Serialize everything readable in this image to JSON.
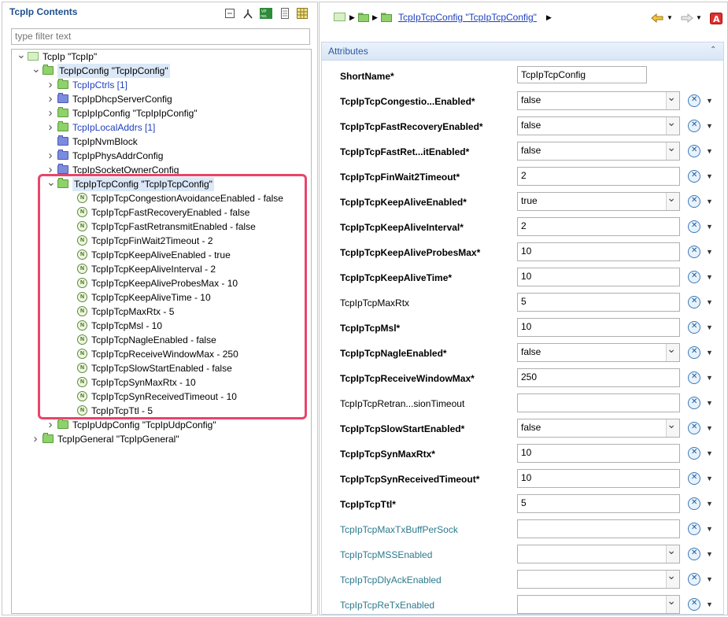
{
  "left": {
    "title": "TcpIp Contents",
    "filter_placeholder": "type filter text",
    "tree": [
      {
        "label": "TcpIp \"TcpIp\"",
        "indent": 0,
        "twisty": "open",
        "icon": "root"
      },
      {
        "label": "TcpIpConfig \"TcpIpConfig\"",
        "indent": 1,
        "twisty": "open",
        "icon": "folder-green",
        "selected": true
      },
      {
        "label": "TcpIpCtrls [1]",
        "indent": 2,
        "twisty": "closed",
        "icon": "folder-green",
        "blue": true
      },
      {
        "label": "TcpIpDhcpServerConfig",
        "indent": 2,
        "twisty": "closed",
        "icon": "folder-blue"
      },
      {
        "label": "TcpIpIpConfig \"TcpIpIpConfig\"",
        "indent": 2,
        "twisty": "closed",
        "icon": "folder-green"
      },
      {
        "label": "TcpIpLocalAddrs [1]",
        "indent": 2,
        "twisty": "closed",
        "icon": "folder-green",
        "blue": true
      },
      {
        "label": "TcpIpNvmBlock",
        "indent": 2,
        "twisty": "none",
        "icon": "folder-blue"
      },
      {
        "label": "TcpIpPhysAddrConfig",
        "indent": 2,
        "twisty": "closed",
        "icon": "folder-blue"
      },
      {
        "label": "TcpIpSocketOwnerConfig",
        "indent": 2,
        "twisty": "closed",
        "icon": "folder-blue"
      },
      {
        "label": "TcpIpTcpConfig \"TcpIpTcpConfig\"",
        "indent": 2,
        "twisty": "open",
        "icon": "folder-green",
        "selected": true
      },
      {
        "label": "TcpIpTcpCongestionAvoidanceEnabled - false",
        "indent": 3,
        "icon": "param"
      },
      {
        "label": "TcpIpTcpFastRecoveryEnabled - false",
        "indent": 3,
        "icon": "param"
      },
      {
        "label": "TcpIpTcpFastRetransmitEnabled - false",
        "indent": 3,
        "icon": "param"
      },
      {
        "label": "TcpIpTcpFinWait2Timeout - 2",
        "indent": 3,
        "icon": "param"
      },
      {
        "label": "TcpIpTcpKeepAliveEnabled - true",
        "indent": 3,
        "icon": "param"
      },
      {
        "label": "TcpIpTcpKeepAliveInterval - 2",
        "indent": 3,
        "icon": "param"
      },
      {
        "label": "TcpIpTcpKeepAliveProbesMax - 10",
        "indent": 3,
        "icon": "param"
      },
      {
        "label": "TcpIpTcpKeepAliveTime - 10",
        "indent": 3,
        "icon": "param"
      },
      {
        "label": "TcpIpTcpMaxRtx - 5",
        "indent": 3,
        "icon": "param"
      },
      {
        "label": "TcpIpTcpMsl - 10",
        "indent": 3,
        "icon": "param"
      },
      {
        "label": "TcpIpTcpNagleEnabled - false",
        "indent": 3,
        "icon": "param"
      },
      {
        "label": "TcpIpTcpReceiveWindowMax - 250",
        "indent": 3,
        "icon": "param"
      },
      {
        "label": "TcpIpTcpSlowStartEnabled - false",
        "indent": 3,
        "icon": "param"
      },
      {
        "label": "TcpIpTcpSynMaxRtx - 10",
        "indent": 3,
        "icon": "param"
      },
      {
        "label": "TcpIpTcpSynReceivedTimeout - 10",
        "indent": 3,
        "icon": "param"
      },
      {
        "label": "TcpIpTcpTtl - 5",
        "indent": 3,
        "icon": "param"
      },
      {
        "label": "TcpIpUdpConfig \"TcpIpUdpConfig\"",
        "indent": 2,
        "twisty": "closed",
        "icon": "folder-green"
      },
      {
        "label": "TcpIpGeneral \"TcpIpGeneral\"",
        "indent": 1,
        "twisty": "closed",
        "icon": "folder-green"
      }
    ]
  },
  "right": {
    "breadcrumb_link": "TcpIpTcpConfig \"TcpIpTcpConfig\"",
    "section_title": "Attributes",
    "attributes": [
      {
        "label": "ShortName*",
        "value": "TcpIpTcpConfig",
        "kind": "text",
        "style": "bold",
        "noreset": true
      },
      {
        "label": "TcpIpTcpCongestio...Enabled*",
        "value": "false",
        "kind": "combo",
        "style": "bold"
      },
      {
        "label": "TcpIpTcpFastRecoveryEnabled*",
        "value": "false",
        "kind": "combo",
        "style": "bold"
      },
      {
        "label": "TcpIpTcpFastRet...itEnabled*",
        "value": "false",
        "kind": "combo",
        "style": "bold"
      },
      {
        "label": "TcpIpTcpFinWait2Timeout*",
        "value": "2",
        "kind": "text",
        "style": "bold"
      },
      {
        "label": "TcpIpTcpKeepAliveEnabled*",
        "value": "true",
        "kind": "combo",
        "style": "bold"
      },
      {
        "label": "TcpIpTcpKeepAliveInterval*",
        "value": "2",
        "kind": "text",
        "style": "bold"
      },
      {
        "label": "TcpIpTcpKeepAliveProbesMax*",
        "value": "10",
        "kind": "text",
        "style": "bold"
      },
      {
        "label": "TcpIpTcpKeepAliveTime*",
        "value": "10",
        "kind": "text",
        "style": "bold"
      },
      {
        "label": "TcpIpTcpMaxRtx",
        "value": "5",
        "kind": "text",
        "style": "normal"
      },
      {
        "label": "TcpIpTcpMsl*",
        "value": "10",
        "kind": "text",
        "style": "bold"
      },
      {
        "label": "TcpIpTcpNagleEnabled*",
        "value": "false",
        "kind": "combo",
        "style": "bold"
      },
      {
        "label": "TcpIpTcpReceiveWindowMax*",
        "value": "250",
        "kind": "text",
        "style": "bold"
      },
      {
        "label": "TcpIpTcpRetran...sionTimeout",
        "value": "",
        "kind": "text",
        "style": "normal"
      },
      {
        "label": "TcpIpTcpSlowStartEnabled*",
        "value": "false",
        "kind": "combo",
        "style": "bold"
      },
      {
        "label": "TcpIpTcpSynMaxRtx*",
        "value": "10",
        "kind": "text",
        "style": "bold"
      },
      {
        "label": "TcpIpTcpSynReceivedTimeout*",
        "value": "10",
        "kind": "text",
        "style": "bold"
      },
      {
        "label": "TcpIpTcpTtl*",
        "value": "5",
        "kind": "text",
        "style": "bold"
      },
      {
        "label": "TcpIpTcpMaxTxBuffPerSock",
        "value": "",
        "kind": "text",
        "style": "teal"
      },
      {
        "label": "TcpIpTcpMSSEnabled",
        "value": "",
        "kind": "combo",
        "style": "teal"
      },
      {
        "label": "TcpIpTcpDlyAckEnabled",
        "value": "",
        "kind": "combo",
        "style": "teal"
      },
      {
        "label": "TcpIpTcpReTxEnabled",
        "value": "",
        "kind": "combo",
        "style": "teal"
      }
    ]
  },
  "colors": {
    "highlight": "#e8456a",
    "link": "#1f3fbf",
    "teal": "#2c7a8c"
  },
  "icons": [
    "collapse-all-icon",
    "hierarchy-icon",
    "vp-res-icon",
    "document-icon",
    "grid-icon",
    "back-arrow-icon",
    "forward-arrow-icon",
    "autosar-icon"
  ]
}
